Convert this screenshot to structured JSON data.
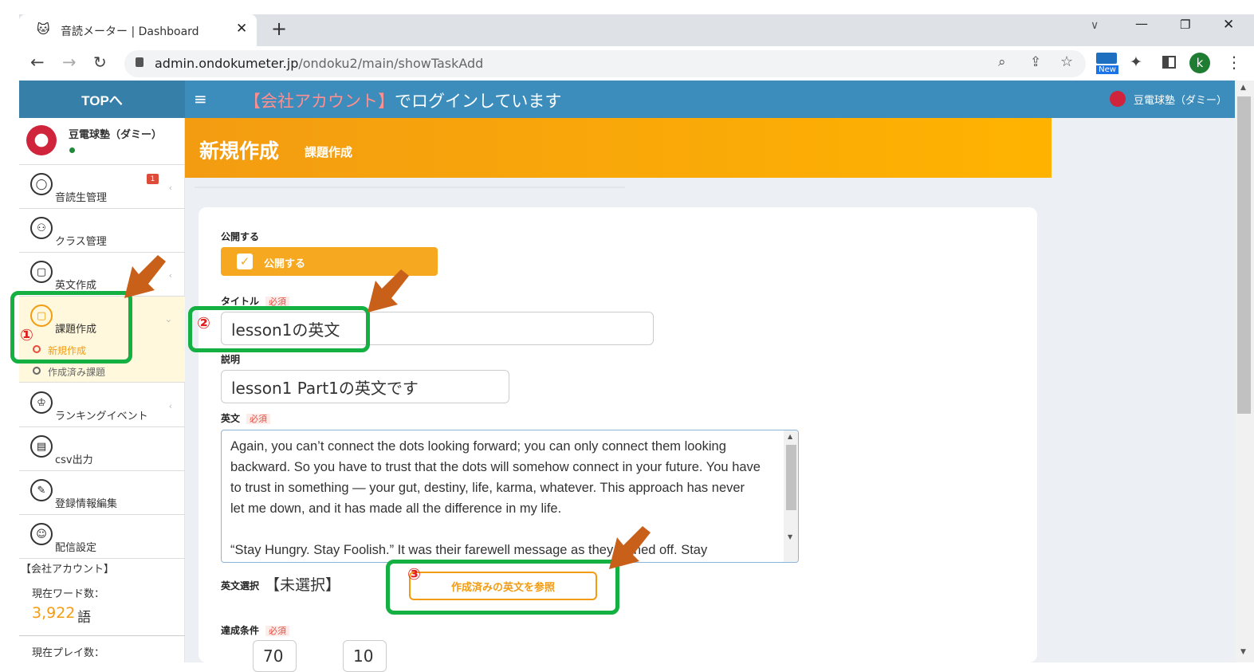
{
  "browser": {
    "tab_title": "音読メーター | Dashboard",
    "url_host": "admin.ondokumeter.jp",
    "url_path": "/ondoku2/main/showTaskAdd",
    "new_badge": "New",
    "profile_initial": "k"
  },
  "topbar": {
    "brand": "TOPへ",
    "menu_icon": "≡",
    "notice_bracket": "【会社アカウント】",
    "notice_rest": "でログインしています",
    "user_name": "豆電球塾（ダミー）"
  },
  "sidebar": {
    "org_name": "豆電球塾（ダミー）",
    "items": [
      {
        "label": "音読生管理",
        "icon": "user-icon",
        "badge": "1"
      },
      {
        "label": "クラス管理",
        "icon": "group-icon"
      },
      {
        "label": "英文作成",
        "icon": "document-icon"
      },
      {
        "label": "課題作成",
        "icon": "note-icon"
      },
      {
        "label": "ランキングイベント",
        "icon": "crown-icon"
      },
      {
        "label": "csv出力",
        "icon": "csv-icon"
      },
      {
        "label": "登録情報編集",
        "icon": "pencil-icon"
      },
      {
        "label": "配信設定",
        "icon": "person-icon"
      }
    ],
    "sub_items": [
      "新規作成",
      "作成済み課題"
    ],
    "account_title": "【会社アカウント】",
    "word_count_label": "現在ワード数：",
    "word_count_value": "3,922",
    "word_count_unit": "語",
    "play_count_label": "現在プレイ数："
  },
  "page": {
    "title": "新規作成",
    "subtitle": "課題作成"
  },
  "form": {
    "publish_label": "公開する",
    "publish_toggle": "公開する",
    "title_label": "タイトル",
    "required": "必須",
    "title_value": "lesson1の英文",
    "desc_label": "説明",
    "desc_value": "lesson1 Part1の英文です",
    "english_label": "英文",
    "english_text": "Again, you can’t connect the dots looking forward; you can only connect them looking backward. So you have to trust that the dots will somehow connect in your future. You have to trust in something — your gut, destiny, life, karma, whatever. This approach has never let me down, and it has made all the difference in my life.\n\n“Stay Hungry. Stay Foolish.” It was their farewell message as they signed off. Stay",
    "select_label": "英文選択",
    "select_value": "【未選択】",
    "ref_button": "作成済みの英文を参照",
    "condition_label": "達成条件",
    "cond_val1": "70",
    "cond_val2": "10"
  },
  "annotations": {
    "n1": "①",
    "n2": "②",
    "n3": "③"
  },
  "colors": {
    "primary": "#3c8dbc",
    "orange": "#f39c12",
    "green": "#14b041",
    "arrow": "#c8601a"
  }
}
